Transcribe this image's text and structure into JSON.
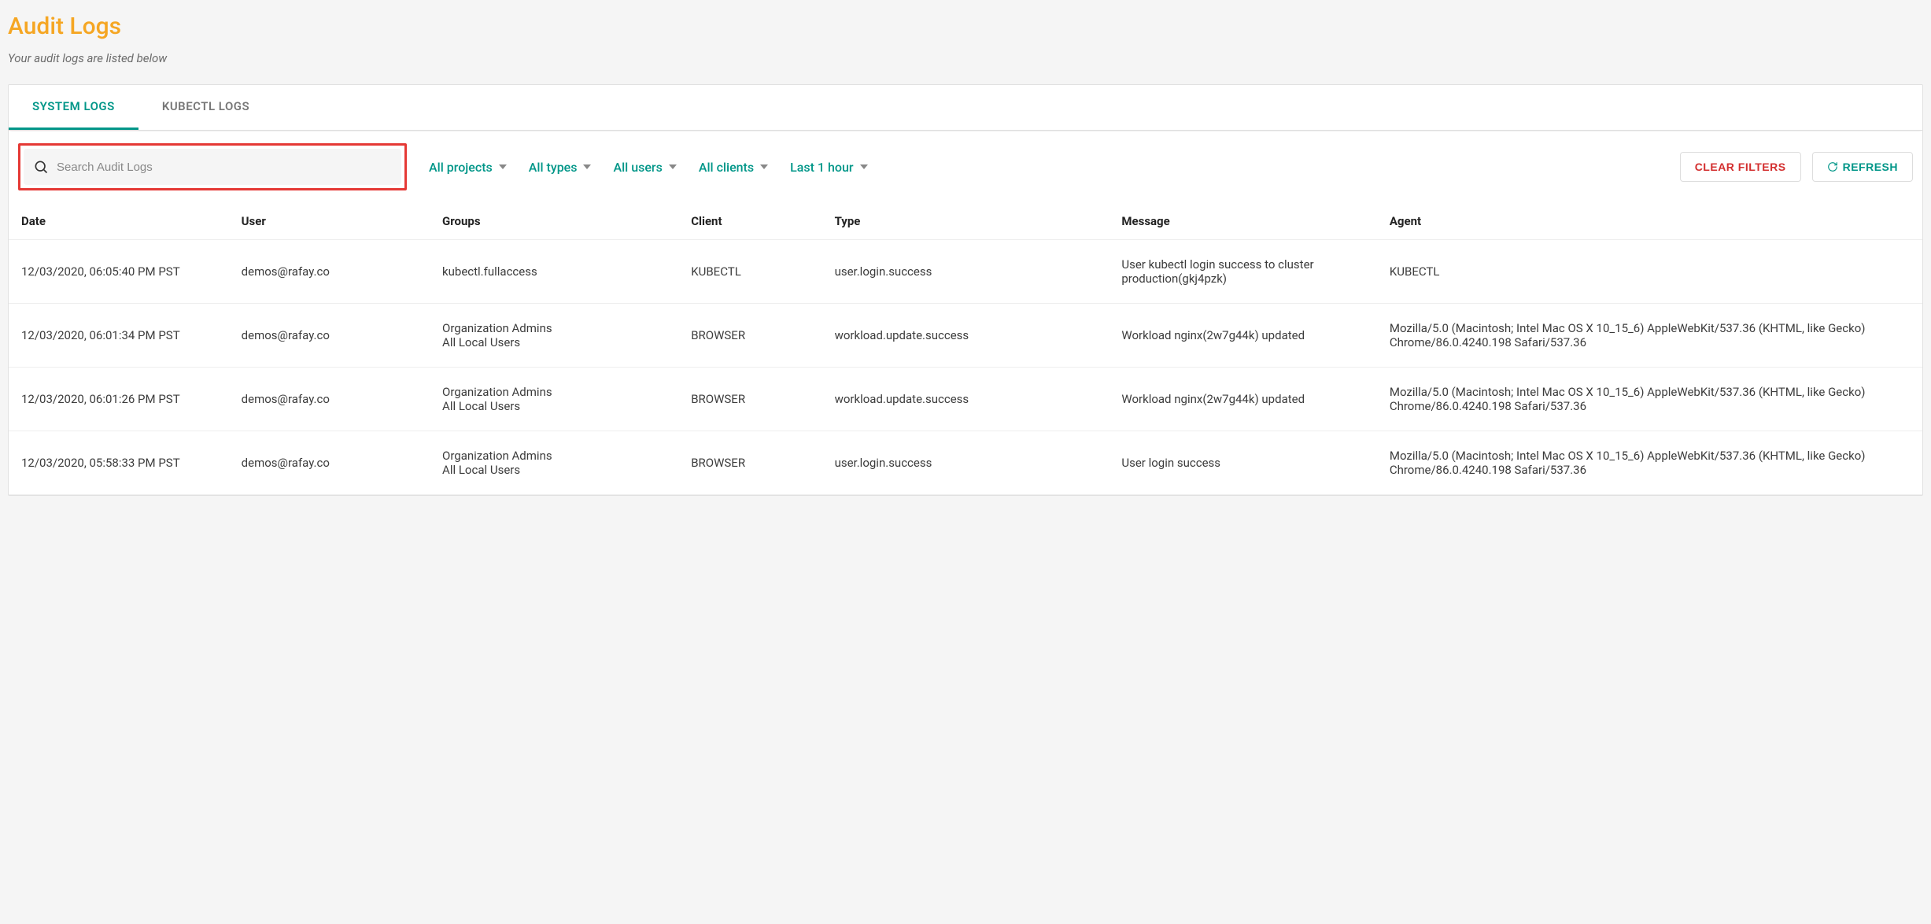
{
  "header": {
    "title": "Audit Logs",
    "subtitle": "Your audit logs are listed below"
  },
  "tabs": {
    "system": "SYSTEM LOGS",
    "kubectl": "KUBECTL LOGS",
    "active": "system"
  },
  "search": {
    "placeholder": "Search Audit Logs",
    "value": ""
  },
  "filters": {
    "projects": "All projects",
    "types": "All types",
    "users": "All users",
    "clients": "All clients",
    "time": "Last 1 hour"
  },
  "actions": {
    "clear": "CLEAR FILTERS",
    "refresh": "REFRESH"
  },
  "table": {
    "columns": {
      "date": "Date",
      "user": "User",
      "groups": "Groups",
      "client": "Client",
      "type": "Type",
      "message": "Message",
      "agent": "Agent"
    },
    "rows": [
      {
        "date": "12/03/2020, 06:05:40 PM PST",
        "user": "demos@rafay.co",
        "groups": "kubectl.fullaccess",
        "client": "KUBECTL",
        "type": "user.login.success",
        "message": "User kubectl login success to cluster production(gkj4pzk)",
        "agent": "KUBECTL"
      },
      {
        "date": "12/03/2020, 06:01:34 PM PST",
        "user": "demos@rafay.co",
        "groups": "Organization Admins\nAll Local Users",
        "client": "BROWSER",
        "type": "workload.update.success",
        "message": "Workload nginx(2w7g44k) updated",
        "agent": "Mozilla/5.0 (Macintosh; Intel Mac OS X 10_15_6) AppleWebKit/537.36 (KHTML, like Gecko) Chrome/86.0.4240.198 Safari/537.36"
      },
      {
        "date": "12/03/2020, 06:01:26 PM PST",
        "user": "demos@rafay.co",
        "groups": "Organization Admins\nAll Local Users",
        "client": "BROWSER",
        "type": "workload.update.success",
        "message": "Workload nginx(2w7g44k) updated",
        "agent": "Mozilla/5.0 (Macintosh; Intel Mac OS X 10_15_6) AppleWebKit/537.36 (KHTML, like Gecko) Chrome/86.0.4240.198 Safari/537.36"
      },
      {
        "date": "12/03/2020, 05:58:33 PM PST",
        "user": "demos@rafay.co",
        "groups": "Organization Admins\nAll Local Users",
        "client": "BROWSER",
        "type": "user.login.success",
        "message": "User login success",
        "agent": "Mozilla/5.0 (Macintosh; Intel Mac OS X 10_15_6) AppleWebKit/537.36 (KHTML, like Gecko) Chrome/86.0.4240.198 Safari/537.36"
      }
    ]
  }
}
